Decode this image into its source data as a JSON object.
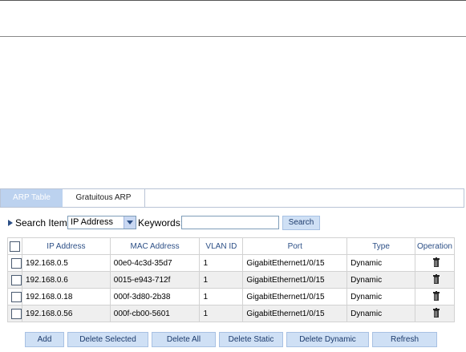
{
  "tabs": [
    {
      "label": "ARP Table",
      "active": true
    },
    {
      "label": "Gratuitous ARP",
      "active": false
    }
  ],
  "search": {
    "label": "Search Item:",
    "selected_item": "IP Address",
    "keywords_label": "Keywords:",
    "keywords_value": "",
    "button": "Search"
  },
  "table": {
    "headers": [
      "IP Address",
      "MAC Address",
      "VLAN ID",
      "Port",
      "Type",
      "Operation"
    ],
    "rows": [
      {
        "ip": "192.168.0.5",
        "mac": "00e0-4c3d-35d7",
        "vlan": "1",
        "port": "GigabitEthernet1/0/15",
        "type": "Dynamic"
      },
      {
        "ip": "192.168.0.6",
        "mac": "0015-e943-712f",
        "vlan": "1",
        "port": "GigabitEthernet1/0/15",
        "type": "Dynamic"
      },
      {
        "ip": "192.168.0.18",
        "mac": "000f-3d80-2b38",
        "vlan": "1",
        "port": "GigabitEthernet1/0/15",
        "type": "Dynamic"
      },
      {
        "ip": "192.168.0.56",
        "mac": "000f-cb00-5601",
        "vlan": "1",
        "port": "GigabitEthernet1/0/15",
        "type": "Dynamic"
      }
    ]
  },
  "actions": {
    "add": "Add",
    "delete_selected": "Delete Selected",
    "delete_all": "Delete All",
    "delete_static": "Delete Static",
    "delete_dynamic": "Delete Dynamic",
    "refresh": "Refresh"
  },
  "colors": {
    "tab_active_bg": "#bcd2ef",
    "button_bg": "#cfe0f5",
    "header_text": "#2c4f86",
    "row_alt_bg": "#efefef"
  },
  "icons": {
    "row_operation": "trash-icon",
    "search_marker": "triangle-right-icon",
    "dropdown": "chevron-down-icon"
  }
}
